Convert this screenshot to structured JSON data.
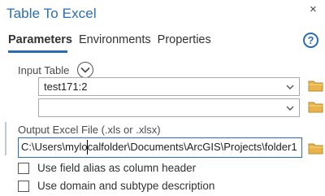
{
  "window": {
    "title": "Table To Excel"
  },
  "tabs": [
    {
      "label": "Parameters",
      "active": true
    },
    {
      "label": "Environments",
      "active": false
    },
    {
      "label": "Properties",
      "active": false
    }
  ],
  "help": {
    "glyph": "?"
  },
  "input_table": {
    "label": "Input Table",
    "rows": [
      {
        "value": "test171:2"
      },
      {
        "value": ""
      }
    ]
  },
  "output": {
    "label": "Output Excel File (.xls or .xlsx)",
    "value": "C:\\Users\\mylocalfolder\\Documents\\ArcGIS\\Projects\\folder1"
  },
  "options": [
    {
      "label": "Use field alias as column header",
      "checked": false
    },
    {
      "label": "Use domain and subtype description",
      "checked": false
    }
  ],
  "colors": {
    "accent": "#2a6eb1",
    "folder": "#e8b44b"
  },
  "icons": {
    "close": "close-icon",
    "help": "help-icon",
    "expand": "chevron-down-circle-icon",
    "dropdown": "chevron-down-icon",
    "browse": "folder-icon"
  }
}
